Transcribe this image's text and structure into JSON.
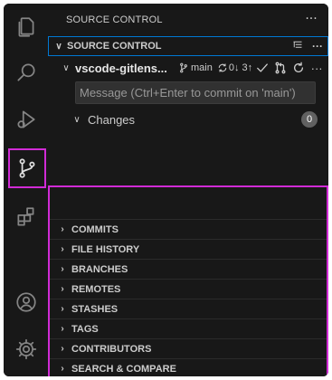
{
  "sidebar": {
    "title": "SOURCE CONTROL",
    "more_glyph": "···"
  },
  "source_control": {
    "header_title": "SOURCE CONTROL",
    "chevron": "∨",
    "repo": {
      "name": "vscode-gitlens...",
      "branch": "main",
      "sync": "0↓ 3↑"
    },
    "commit_placeholder": "Message (Ctrl+Enter to commit on 'main')",
    "changes": {
      "label": "Changes",
      "count": "0"
    }
  },
  "panels": [
    {
      "label": "COMMITS"
    },
    {
      "label": "FILE HISTORY"
    },
    {
      "label": "BRANCHES"
    },
    {
      "label": "REMOTES"
    },
    {
      "label": "STASHES"
    },
    {
      "label": "TAGS"
    },
    {
      "label": "CONTRIBUTORS"
    },
    {
      "label": "SEARCH & COMPARE"
    }
  ],
  "activity_bar": {
    "items": [
      "explorer-icon",
      "search-icon",
      "run-debug-icon",
      "source-control-icon",
      "extensions-icon",
      "accounts-icon",
      "manage-gear-icon"
    ],
    "active": "source-control-icon",
    "highlight_color": "#d12bd6"
  },
  "colors": {
    "background": "#181818",
    "focus_border": "#0078d4",
    "highlight": "#d12bd6"
  }
}
